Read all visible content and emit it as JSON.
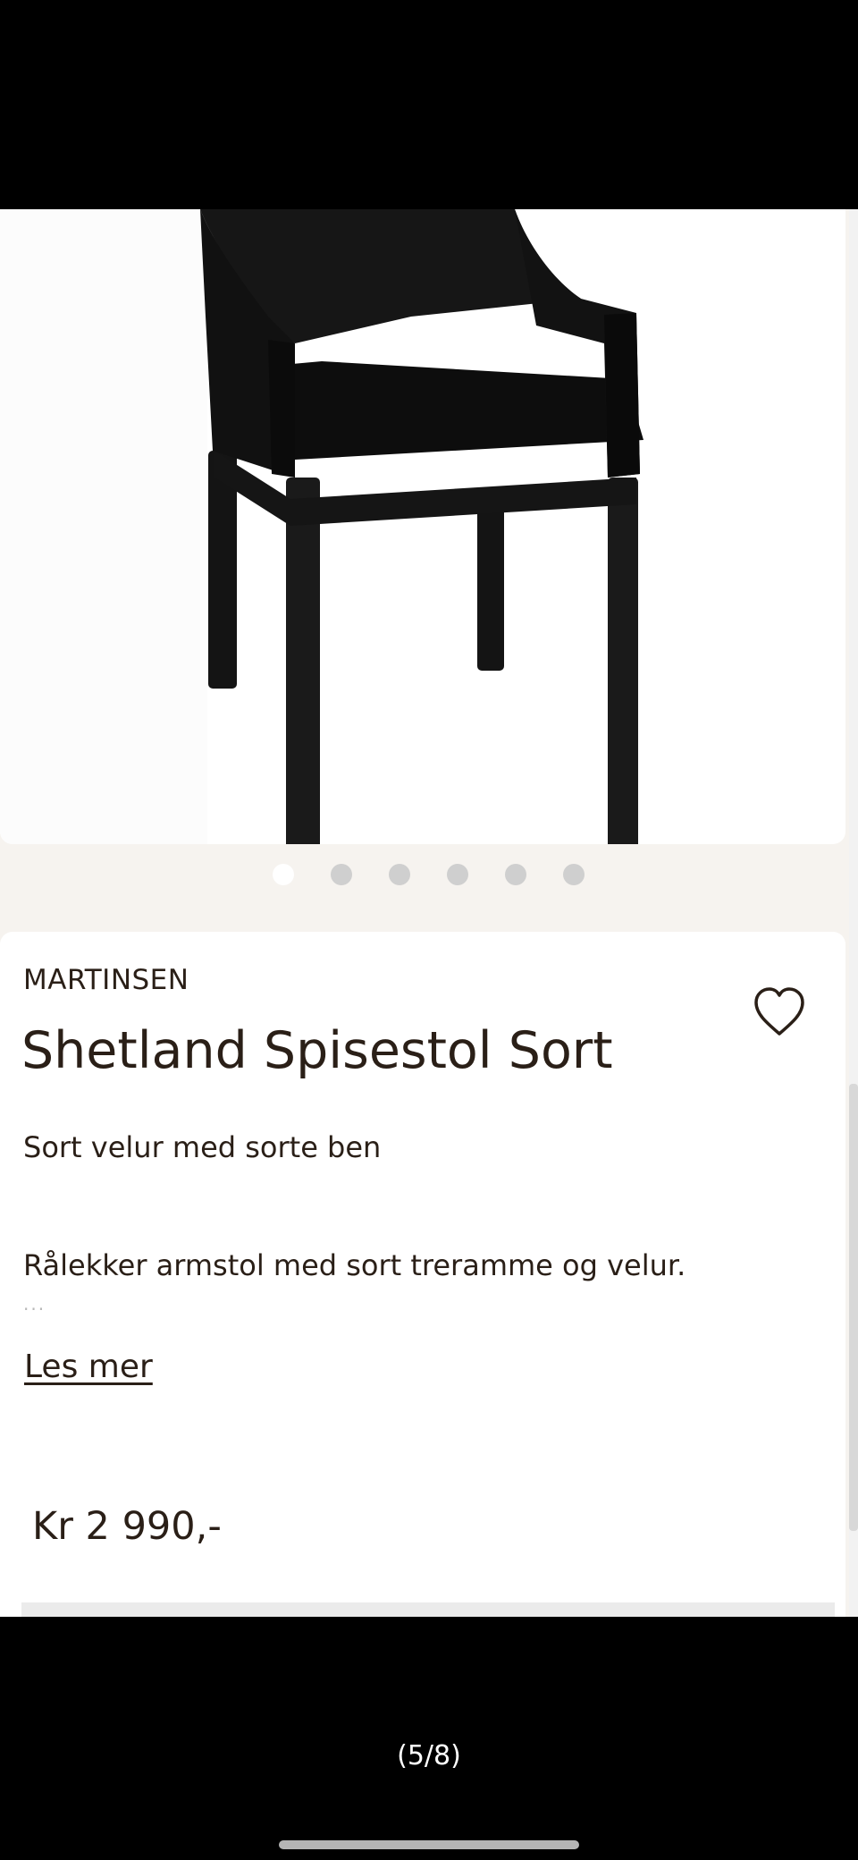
{
  "carousel": {
    "image_alt": "Shetland Spisestol Sort",
    "slide_count": 6,
    "active_index": 0
  },
  "product": {
    "brand": "MARTINSEN",
    "title": "Shetland Spisestol Sort",
    "subtitle": "Sort velur med sorte ben",
    "description": "Rålekker armstol med sort treramme og velur.",
    "ellipsis": "...",
    "read_more_label": "Les mer",
    "price": "Kr 2 990,-",
    "favorite_icon": "heart-outline-icon"
  },
  "viewer": {
    "counter": "(5/8)"
  },
  "colors": {
    "text": "#2a1f17",
    "background": "#f6f3ef",
    "card": "#ffffff",
    "dot_inactive": "#cfcfcf"
  }
}
